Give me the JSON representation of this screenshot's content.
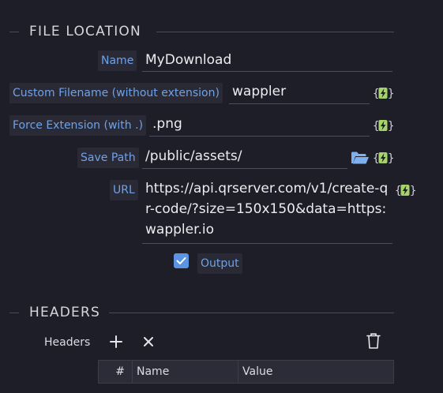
{
  "file_location": {
    "title": "FILE LOCATION",
    "name": {
      "label": "Name",
      "value": "MyDownload"
    },
    "custom_filename": {
      "label": "Custom Filename (without extension)",
      "value": "wappler"
    },
    "force_extension": {
      "label": "Force Extension (with .)",
      "value": ".png"
    },
    "save_path": {
      "label": "Save Path",
      "value": "/public/assets/"
    },
    "url": {
      "label": "URL",
      "value": "https://api.qrserver.com/v1/create-qr-code/?size=150x150&data=https:wappler.io"
    },
    "output": {
      "label": "Output",
      "checked": true
    }
  },
  "headers_section": {
    "title": "HEADERS",
    "headers_label": "Headers",
    "table": {
      "columns": [
        "#",
        "Name",
        "Value"
      ]
    }
  },
  "icons": {
    "dynamic": "lightning-icon",
    "folder": "folder-open-icon",
    "add": "plus-icon",
    "remove": "x-icon",
    "delete": "trash-icon",
    "check": "check-icon"
  },
  "colors": {
    "background": "#1e1e28",
    "label_text": "#6ea2e8",
    "label_bg": "#2a2a36",
    "dynamic_icon": "#a6d36a",
    "folder_icon": "#7fb0ee",
    "checkbox": "#5b94e2"
  }
}
